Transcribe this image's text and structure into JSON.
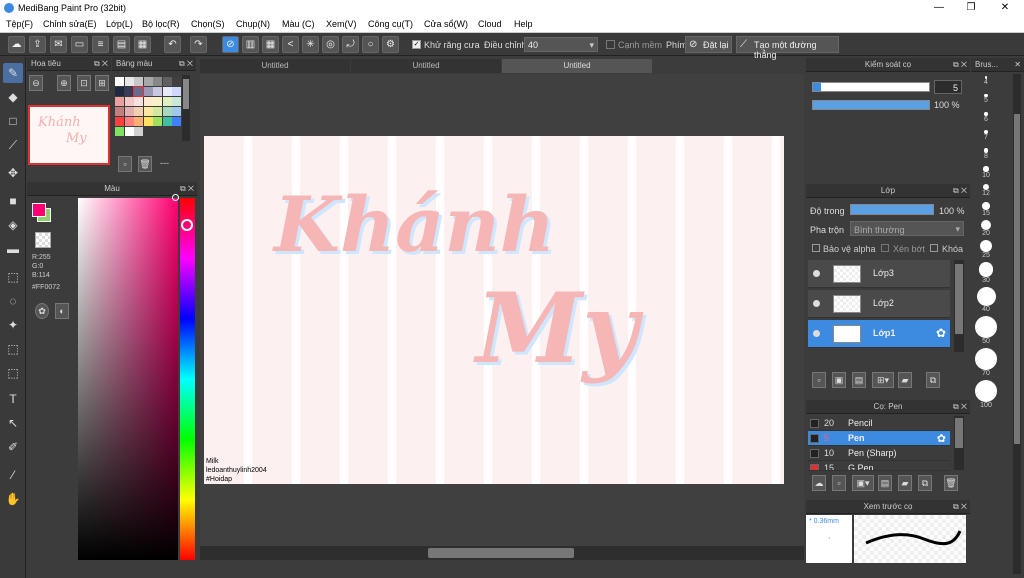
{
  "app": {
    "title": "MediBang Paint Pro (32bit)",
    "min": "—",
    "max": "❐",
    "close": "✕"
  },
  "menu": [
    "Tệp(F)",
    "Chỉnh sửa(E)",
    "Lớp(L)",
    "Bộ lọc(R)",
    "Chọn(S)",
    "Chụp(N)",
    "Màu (C)",
    "Xem(V)",
    "Công cụ(T)",
    "Cửa sổ(W)",
    "Cloud",
    "Help"
  ],
  "toolbar": {
    "antialias": "Khử răng cưa",
    "correction_label": "Điều chỉnh",
    "correction_value": "40",
    "soft_edge": "Cạnh mềm",
    "shortcut": "Phím",
    "reset": "Đặt lại",
    "straight": "Tạo một đường thẳng"
  },
  "panels": {
    "navigator": "Hoa tiêu",
    "palette": "Bảng màu",
    "palette_dash": "---",
    "color": "Màu",
    "brush_control": "Kiểm soát cọ",
    "layer": "Lớp",
    "brush_list": "Cọ: Pen",
    "preview": "Xem trước cọ",
    "brush_size": "Brus..."
  },
  "tabs": [
    "Untitled",
    "Untitled",
    "Untitled"
  ],
  "color": {
    "r": "R:255",
    "g": "G:0",
    "b": "B:114",
    "hex": "#FF0072",
    "fg": "#ff0072",
    "bg": "#8ed36a"
  },
  "brush_control": {
    "size": "5",
    "opacity": "100 %"
  },
  "layer_panel": {
    "opacity_label": "Độ trong",
    "opacity_value": "100 %",
    "blend_label": "Pha trộn",
    "blend_value": "Bình thường",
    "protect_alpha": "Bảo vệ alpha",
    "clipping": "Xén bớt",
    "lock": "Khóa",
    "layers": [
      "Lớp3",
      "Lớp2",
      "Lớp1"
    ]
  },
  "brushes": [
    {
      "size": "20",
      "name": "Pencil"
    },
    {
      "size": "5",
      "name": "Pen"
    },
    {
      "size": "10",
      "name": "Pen (Sharp)"
    },
    {
      "size": "15",
      "name": "G Pen"
    }
  ],
  "preview": {
    "size": "* 0.36mm"
  },
  "canvas": {
    "line1": "Khánh",
    "line2": "My",
    "credit1": "Milk",
    "credit2": "ledoanthuylinh2004",
    "credit3": "#Hoidap"
  },
  "brush_sizes": [
    "4",
    "5",
    "6",
    "7",
    "8",
    "10",
    "12",
    "15",
    "20",
    "25",
    "30",
    "40",
    "50",
    "70",
    "100"
  ]
}
